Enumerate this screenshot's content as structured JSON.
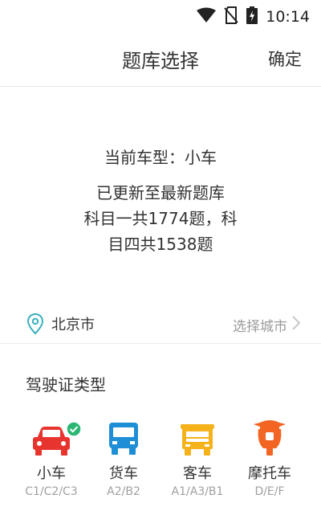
{
  "status_bar": {
    "time": "10:14"
  },
  "header": {
    "title": "题库选择",
    "confirm_label": "确定"
  },
  "summary": {
    "line1": "当前车型：小车",
    "line2": "已更新至最新题库",
    "line3": "科目一共1774题，科",
    "line4": "目四共1538题"
  },
  "city": {
    "name": "北京市",
    "choose_label": "选择城市"
  },
  "license": {
    "title": "驾驶证类型",
    "vehicles": [
      {
        "name": "小车",
        "code": "C1/C2/C3",
        "icon": "car-icon",
        "color": "#e8342f",
        "selected": true
      },
      {
        "name": "货车",
        "code": "A2/B2",
        "icon": "truck-icon",
        "color": "#1e8fd6",
        "selected": false
      },
      {
        "name": "客车",
        "code": "A1/A3/B1",
        "icon": "bus-icon",
        "color": "#f5b21b",
        "selected": false
      },
      {
        "name": "摩托车",
        "code": "D/E/F",
        "icon": "motorcycle-icon",
        "color": "#f26522",
        "selected": false
      }
    ]
  },
  "colors": {
    "accent_green": "#2bb673",
    "location_teal": "#3ab0c0"
  }
}
